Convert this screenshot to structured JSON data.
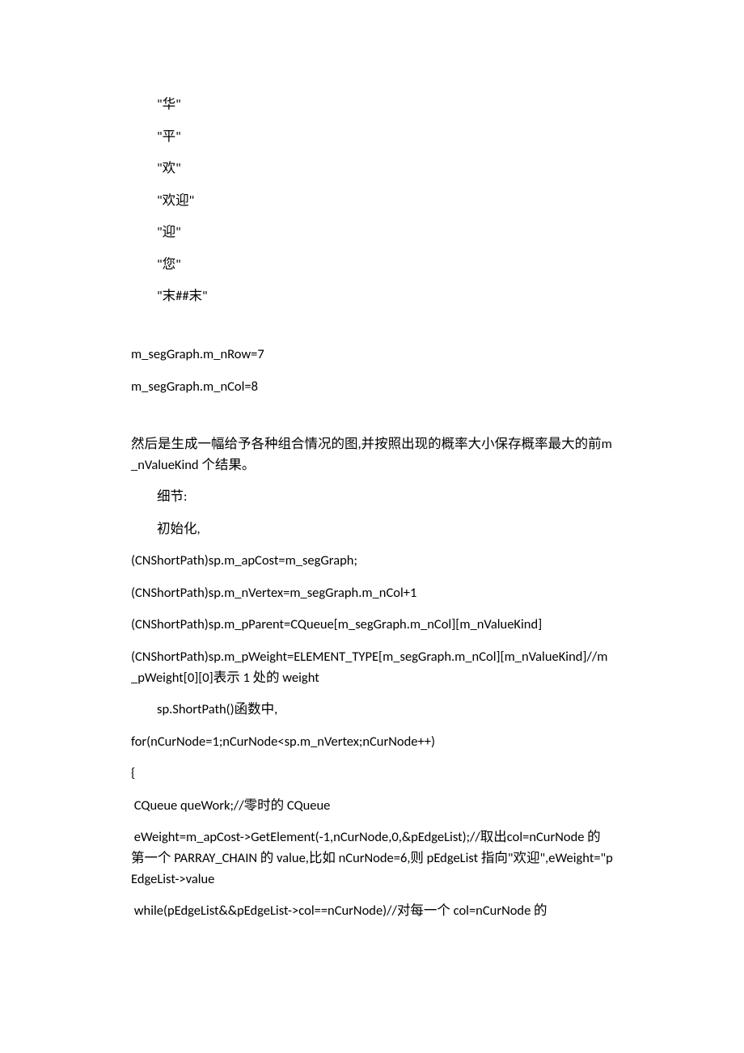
{
  "lines": [
    {
      "text": "\"华\"",
      "indent": true
    },
    {
      "text": "\"平\"",
      "indent": true
    },
    {
      "text": "\"欢\"",
      "indent": true
    },
    {
      "text": "\"欢迎\"",
      "indent": true
    },
    {
      "text": "\"迎\"",
      "indent": true
    },
    {
      "text": "\"您\"",
      "indent": true
    },
    {
      "text": "\"末##末\"",
      "indent": true
    },
    {
      "spacer": true
    },
    {
      "text": "m_segGraph.m_nRow=7",
      "indent": false
    },
    {
      "text": "m_segGraph.m_nCol=8",
      "indent": false
    },
    {
      "spacer": true
    },
    {
      "text": "然后是生成一幅给予各种组合情况的图,并按照出现的概率大小保存概率最大的前m_nValueKind 个结果。",
      "indent": false
    },
    {
      "text": "细节:",
      "indent": true
    },
    {
      "text": "初始化,",
      "indent": true
    },
    {
      "text": "(CNShortPath)sp.m_apCost=m_segGraph;",
      "indent": false
    },
    {
      "text": "(CNShortPath)sp.m_nVertex=m_segGraph.m_nCol+1",
      "indent": false
    },
    {
      "text": "(CNShortPath)sp.m_pParent=CQueue[m_segGraph.m_nCol][m_nValueKind]",
      "indent": false
    },
    {
      "text": "(CNShortPath)sp.m_pWeight=ELEMENT_TYPE[m_segGraph.m_nCol][m_nValueKind]//m_pWeight[0][0]表示 1 处的 weight",
      "indent": false
    },
    {
      "text": "sp.ShortPath()函数中,",
      "indent": true
    },
    {
      "text": "for(nCurNode=1;nCurNode<sp.m_nVertex;nCurNode++)",
      "indent": false
    },
    {
      "text": "{",
      "indent": false
    },
    {
      "text": " CQueue queWork;//零时的 CQueue",
      "indent": false
    },
    {
      "text": " eWeight=m_apCost->GetElement(-1,nCurNode,0,&pEdgeList);//取出col=nCurNode 的第一个 PARRAY_CHAIN 的 value,比如 nCurNode=6,则 pEdgeList 指向\"欢迎\",eWeight=\"pEdgeList->value",
      "indent": false
    },
    {
      "text": " while(pEdgeList&&pEdgeList->col==nCurNode)//对每一个 col=nCurNode 的",
      "indent": false
    }
  ]
}
